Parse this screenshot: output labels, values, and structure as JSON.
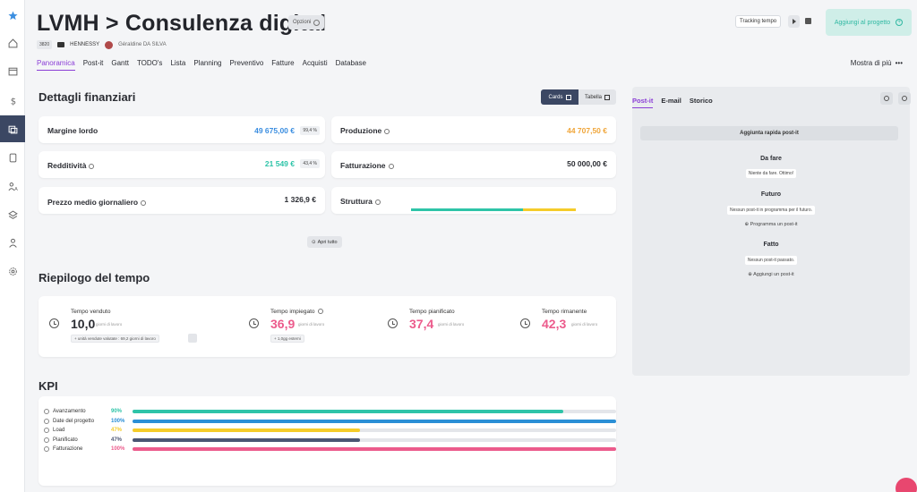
{
  "header": {
    "title": "LVMH > Consulenza digital",
    "options_label": "Opzioni",
    "code": "3820",
    "client": "HENNESSY",
    "owner": "Géraldine DA SILVA",
    "tracking_label": "Tracking tempo",
    "add_project_label": "Aggiungi al progetto"
  },
  "tabs": [
    "Panoramica",
    "Post-it",
    "Gantt",
    "TODO's",
    "Lista",
    "Planning",
    "Preventivo",
    "Fatture",
    "Acquisti",
    "Database"
  ],
  "more_label": "Mostra di più",
  "financial": {
    "title": "Dettagli finanziari",
    "toggle": {
      "cards": "Cards",
      "table": "Tabella"
    },
    "margin": {
      "label": "Margine lordo",
      "value": "49 675,00 €",
      "pct": "99,4 %"
    },
    "production": {
      "label": "Produzione",
      "value": "44 707,50 €"
    },
    "profitability": {
      "label": "Redditività",
      "value": "21 549 €",
      "pct": "43,4 %"
    },
    "billing": {
      "label": "Fatturazione",
      "value": "50 000,00 €"
    },
    "daily_rate": {
      "label": "Prezzo medio giornaliero",
      "value": "1 326,9 €"
    },
    "structure": {
      "label": "Struttura",
      "split": [
        0.68,
        0.32
      ]
    },
    "open_all": "Apri tutto"
  },
  "time": {
    "title": "Riepilogo del tempo",
    "unit": "giorni di lavoro",
    "sold": {
      "label": "Tempo venduto",
      "value": "10,0",
      "sub": "+ unità vendute valutate : 69,2 giorni di lavoro"
    },
    "spent": {
      "label": "Tempo impiegato",
      "value": "36,9",
      "sub": "+ 1,0gg esterni"
    },
    "planned": {
      "label": "Tempo pianificato",
      "value": "37,4"
    },
    "remaining": {
      "label": "Tempo rimanente",
      "value": "42,3"
    }
  },
  "kpi": {
    "title": "KPI",
    "rows": [
      {
        "name": "Avanzamento",
        "pct": "90%",
        "fill": 0.89,
        "color": "#2ec4a8"
      },
      {
        "name": "Date del progetto",
        "pct": "100%",
        "fill": 1.0,
        "color": "#2b8fd6"
      },
      {
        "name": "Load",
        "pct": "47%",
        "fill": 0.47,
        "color": "#f5cc2a"
      },
      {
        "name": "Pianificato",
        "pct": "47%",
        "fill": 0.47,
        "color": "#4a5573"
      },
      {
        "name": "Fatturazione",
        "pct": "100%",
        "fill": 1.0,
        "color": "#ec5b8c"
      }
    ]
  },
  "postit": {
    "tabs": [
      "Post-it",
      "E-mail",
      "Storico"
    ],
    "quick_add": "Aggiunta rapida post-it",
    "todo": {
      "title": "Da fare",
      "note": "Niente da fare. Ottimo!"
    },
    "future": {
      "title": "Futuro",
      "note": "Nessun post-it in programma per il futuro.",
      "action": "Programma un post-it"
    },
    "done": {
      "title": "Fatto",
      "note": "Nessun post-it passato.",
      "action": "Aggiungi un post-it"
    }
  },
  "colors": {
    "accent": "#8b3ed6",
    "teal": "#2ec4a8",
    "blue": "#2b8fd6",
    "orange": "#f0a63a",
    "pink": "#ec5b8c",
    "navy": "#3b4763"
  }
}
